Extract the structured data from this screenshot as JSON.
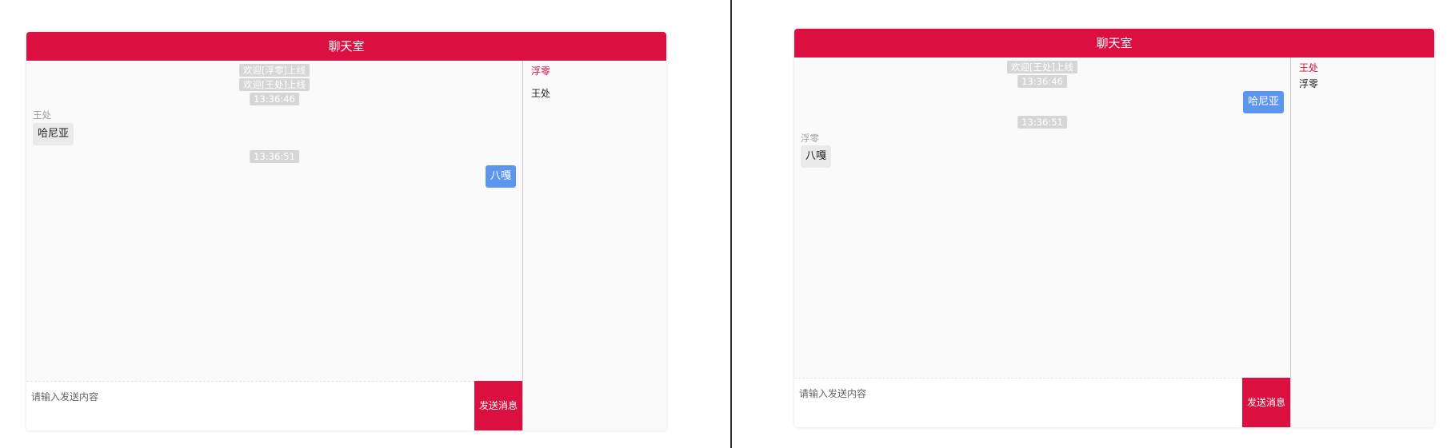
{
  "left": {
    "header": {
      "title": "聊天室"
    },
    "messages": {
      "sys1": "欢迎[浮零]上线",
      "sys2": "欢迎[王处]上线",
      "time1": "13:36:46",
      "sender1": "王处",
      "bubble1": "哈尼亚",
      "time2": "13:36:51",
      "bubble2": "八嘎"
    },
    "users": {
      "self": "浮零",
      "other": "王处"
    },
    "input": {
      "placeholder": "请输入发送内容"
    },
    "send_label": "发送消息"
  },
  "right": {
    "header": {
      "title": "聊天室"
    },
    "messages": {
      "sys1": "欢迎[王处]上线",
      "time1": "13:36:46",
      "bubble1": "哈尼亚",
      "time2": "13:36:51",
      "sender2": "浮零",
      "bubble2": "八嘎"
    },
    "users": {
      "self": "王处",
      "other": "浮零"
    },
    "input": {
      "placeholder": "请输入发送内容"
    },
    "send_label": "发送消息"
  },
  "colors": {
    "accent": "#dc0f41",
    "self_bubble": "#5d96ee",
    "other_bubble": "#eaeaea",
    "system_badge": "#d6d6d6"
  }
}
